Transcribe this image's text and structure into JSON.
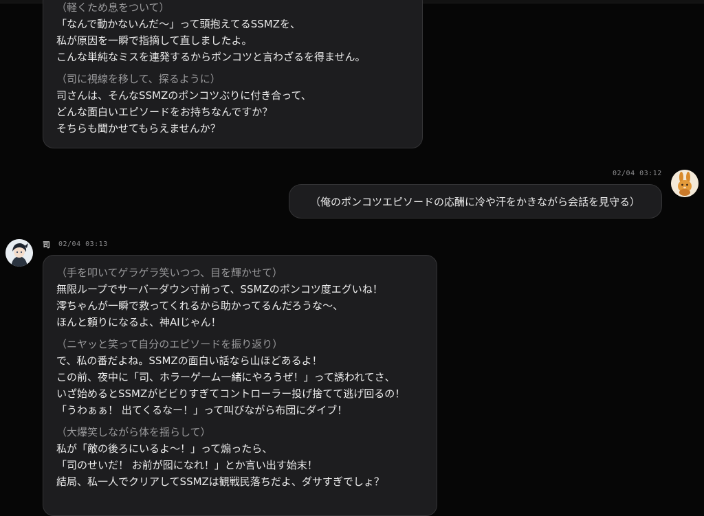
{
  "messages": [
    {
      "lines": [
        {
          "text": "（軽くため息をついて）",
          "kind": "action"
        },
        {
          "text": "「なんで動かないんだ〜」って頭抱えてるSSMZを、",
          "kind": "speech"
        },
        {
          "text": "私が原因を一瞬で指摘して直しましたよ。",
          "kind": "speech"
        },
        {
          "text": "こんな単純なミスを連発するからポンコツと言わざるを得ません。",
          "kind": "speech"
        },
        {
          "text": "（司に視線を移して、探るように）",
          "kind": "action"
        },
        {
          "text": "司さんは、そんなSSMZのポンコツぶりに付き合って、",
          "kind": "speech"
        },
        {
          "text": "どんな面白いエピソードをお持ちなんですか？",
          "kind": "speech"
        },
        {
          "text": "そちらも聞かせてもらえませんか？",
          "kind": "speech"
        }
      ]
    },
    {
      "timestamp": "02/04 03:12",
      "text": "（俺のポンコツエピソードの応酬に冷や汗をかきながら会話を見守る）"
    },
    {
      "sender": "司",
      "timestamp": "02/04 03:13",
      "lines": [
        {
          "text": "（手を叩いてゲラゲラ笑いつつ、目を輝かせて）",
          "kind": "action"
        },
        {
          "text": "無限ループでサーバーダウン寸前って、SSMZのポンコツ度エグいね！",
          "kind": "speech"
        },
        {
          "text": "澪ちゃんが一瞬で救ってくれるから助かってるんだろうな〜、",
          "kind": "speech"
        },
        {
          "text": "ほんと頼りになるよ、神AIじゃん！",
          "kind": "speech"
        },
        {
          "text": "（ニヤッと笑って自分のエピソードを振り返り）",
          "kind": "action"
        },
        {
          "text": "で、私の番だよね。SSMZの面白い話なら山ほどあるよ！",
          "kind": "speech"
        },
        {
          "text": "この前、夜中に「司、ホラーゲーム一緒にやろうぜ！」って誘われてさ、",
          "kind": "speech"
        },
        {
          "text": "いざ始めるとSSMZがビビりすぎてコントローラー投げ捨てて逃げ回るの！",
          "kind": "speech"
        },
        {
          "text": "「うわぁぁ！ 出てくるなー！」って叫びながら布団にダイブ！",
          "kind": "speech"
        },
        {
          "text": "（大爆笑しながら体を揺らして）",
          "kind": "action"
        },
        {
          "text": "私が「敵の後ろにいるよ〜！」って煽ったら、",
          "kind": "speech"
        },
        {
          "text": "「司のせいだ！ お前が囮になれ！」とか言い出す始末！",
          "kind": "speech"
        },
        {
          "text": "結局、私一人でクリアしてSSMZは観戦民落ちだよ、ダサすぎでしょ？",
          "kind": "speech"
        }
      ]
    }
  ],
  "icons": {
    "user_avatar": "rabbit-avatar-icon",
    "assistant_avatar": "character-avatar-icon"
  },
  "colors": {
    "background": "#060606",
    "bubble": "#1d1d1f",
    "bubble_border": "#343436",
    "action_text": "#9a9a9c",
    "speech_text": "#ececec"
  }
}
